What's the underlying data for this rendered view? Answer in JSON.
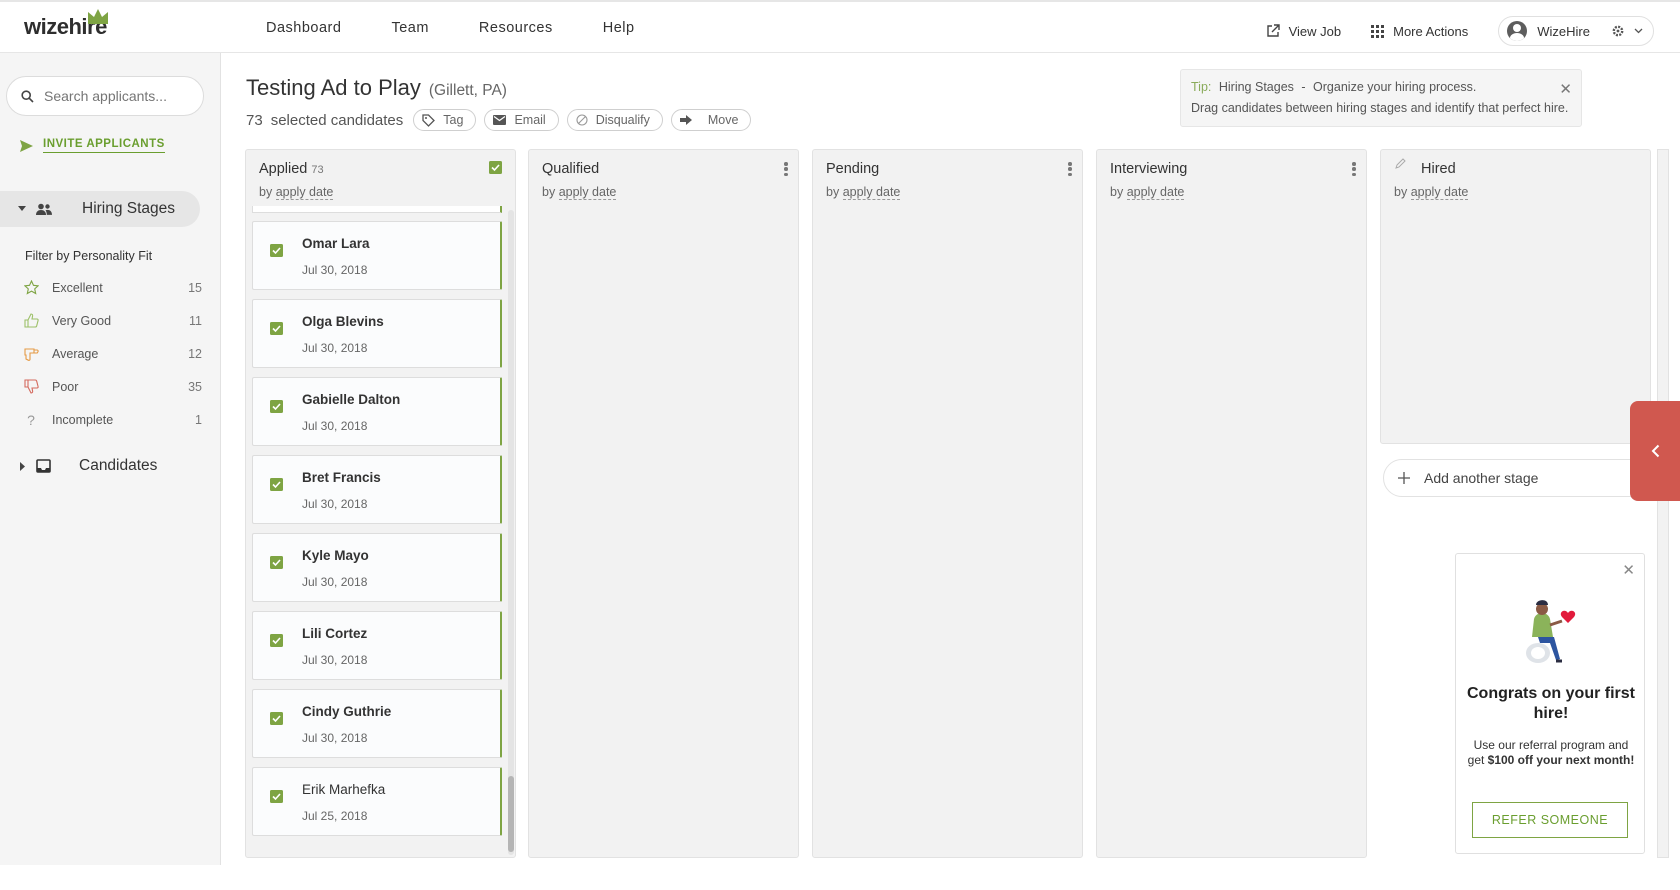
{
  "brand": {
    "logo": "wizehire",
    "accent": "#7ea443",
    "alert": "#d0584f"
  },
  "nav": [
    "Dashboard",
    "Team",
    "Resources",
    "Help"
  ],
  "top_actions": {
    "view_job": "View Job",
    "more_actions": "More Actions",
    "user": "WizeHire"
  },
  "sidebar": {
    "search_placeholder": "Search applicants...",
    "invite": "INVITE APPLICANTS",
    "hiring_stages": "Hiring Stages",
    "filter_title": "Filter by Personality Fit",
    "filters": [
      {
        "label": "Excellent",
        "count": "15",
        "icon": "star-icon"
      },
      {
        "label": "Very Good",
        "count": "11",
        "icon": "thumbs-up-icon"
      },
      {
        "label": "Average",
        "count": "12",
        "icon": "thumbs-sideways-icon"
      },
      {
        "label": "Poor",
        "count": "35",
        "icon": "thumbs-down-icon"
      },
      {
        "label": "Incomplete",
        "count": "1",
        "icon": "question-icon"
      }
    ],
    "candidates": "Candidates"
  },
  "job": {
    "title": "Testing Ad to Play",
    "location": "(Gillett, PA)",
    "selected_count": "73",
    "selected_label": "selected candidates",
    "actions": [
      "Tag",
      "Email",
      "Disqualify",
      "Move"
    ]
  },
  "tip": {
    "label": "Tip:",
    "heading": "Hiring Stages",
    "sep": "-",
    "line1": "Organize your hiring process.",
    "line2": "Drag candidates between hiring stages and identify that perfect hire."
  },
  "columns": [
    {
      "title": "Applied",
      "count": "73",
      "by": "by",
      "sort": "apply date"
    },
    {
      "title": "Qualified",
      "by": "by",
      "sort": "apply date"
    },
    {
      "title": "Pending",
      "by": "by",
      "sort": "apply date"
    },
    {
      "title": "Interviewing",
      "by": "by",
      "sort": "apply date"
    },
    {
      "title": "Hired",
      "by": "by",
      "sort": "apply date"
    }
  ],
  "candidates": [
    {
      "name": "Omar Lara",
      "date": "Jul 30, 2018"
    },
    {
      "name": "Olga Blevins",
      "date": "Jul 30, 2018"
    },
    {
      "name": "Gabielle Dalton",
      "date": "Jul 30, 2018"
    },
    {
      "name": "Bret Francis",
      "date": "Jul 30, 2018"
    },
    {
      "name": "Kyle Mayo",
      "date": "Jul 30, 2018"
    },
    {
      "name": "Lili Cortez",
      "date": "Jul 30, 2018"
    },
    {
      "name": "Cindy Guthrie",
      "date": "Jul 30, 2018"
    },
    {
      "name": "Erik Marhefka",
      "date": "Jul 25, 2018"
    }
  ],
  "add_stage": "Add another stage",
  "congrats": {
    "title": "Congrats on your first hire!",
    "text_a": "Use our referral program and get ",
    "text_bold": "$100 off your next month!",
    "button": "REFER SOMEONE"
  }
}
